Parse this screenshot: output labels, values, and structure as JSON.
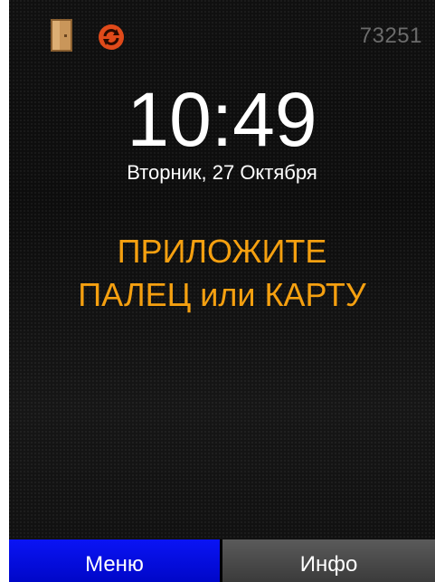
{
  "status_bar": {
    "door_icon": "door-icon",
    "sync_icon": "sync-icon",
    "device_id": "73251",
    "colors": {
      "door": "#b88a52",
      "sync": "#e04a1a",
      "device_id": "#6b6b6b"
    }
  },
  "clock": {
    "time": "10:49",
    "date": "Вторник, 27 Октября"
  },
  "prompt": {
    "line1": "ПРИЛОЖИТЕ",
    "line2": "ПАЛЕЦ или КАРТУ",
    "color": "#f5a010"
  },
  "bottom_bar": {
    "menu_label": "Меню",
    "info_label": "Инфо",
    "colors": {
      "menu": "#0007e0",
      "info": "#4a4a4a"
    }
  }
}
